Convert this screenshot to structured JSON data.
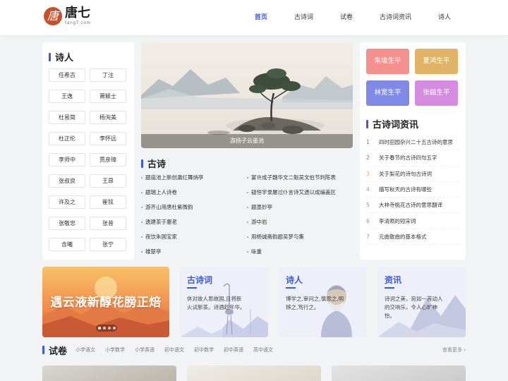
{
  "header": {
    "logo_mark": "唐",
    "logo_name": "唐七",
    "logo_url": "tang7.com",
    "nav": [
      "首页",
      "古诗词",
      "试卷",
      "古诗词资讯",
      "诗人"
    ],
    "active_nav": 0
  },
  "poets": {
    "title": "诗人",
    "items": [
      "任希古",
      "丁注",
      "王逸",
      "萧颖士",
      "杜易简",
      "杨洵美",
      "杜正伦",
      "李怀远",
      "李师中",
      "贾彦璋",
      "张叔良",
      "王昂",
      "许及之",
      "崔铉",
      "张敬忠",
      "张昔",
      "含曦",
      "张宁"
    ]
  },
  "hero": {
    "caption": "游扬子云墨池"
  },
  "gushi": {
    "title": "古诗",
    "items": [
      "题庙池上新创瀛红舞绡亭",
      "宴许成子魏华文二魁吴文伯节判陈表",
      "题瑞上人诗卷",
      "疑恒学录屡过仆言诗又遗以成编盖区",
      "游齐山用唐杜紫微韵",
      "题墨妙亭",
      "遗建茶于惠老",
      "游中岩",
      "夜饮朱国宝家",
      "用杨诚斋韵题吴梦与集",
      "雄楚亭",
      "咏重"
    ]
  },
  "right": {
    "tiles": [
      {
        "label": "朱埴生平",
        "color": "#f4918f"
      },
      {
        "label": "夏鸿生平",
        "color": "#e0b366"
      },
      {
        "label": "林宽生平",
        "color": "#7e8ae6"
      },
      {
        "label": "张鎡生平",
        "color": "#d58be0"
      }
    ],
    "news_title": "古诗词资讯",
    "news": [
      {
        "num": "1",
        "text": "四时田园杂兴二十五古诗的意思"
      },
      {
        "num": "2",
        "text": "关于春节的古诗四句五字"
      },
      {
        "num": "3",
        "text": "关于梨花的诗句古诗词"
      },
      {
        "num": "4",
        "text": "描写秋天的古诗有哪些"
      },
      {
        "num": "5",
        "text": "大林寺桃花古诗的意思翻译"
      },
      {
        "num": "6",
        "text": "李清照的短宋词"
      },
      {
        "num": "7",
        "text": "元曲散曲的基本格式"
      }
    ]
  },
  "banner": {
    "text": "遇云液新醇花膀正焙"
  },
  "cards": [
    {
      "title": "古诗词",
      "desc": "休对故人思故国,且将新火试新茶。诗酒趁年华。"
    },
    {
      "title": "诗人",
      "desc": "博学之,审问之,慎思之,明辨之,笃行之。"
    },
    {
      "title": "资讯",
      "desc": "诗词之美，宛如一首动人的交响乐，令人心旷神怡。"
    }
  ],
  "exam": {
    "title": "试卷",
    "tabs": [
      "小学语文",
      "小学数学",
      "小学英语",
      "初中语文",
      "初中数学",
      "初中英语",
      "高中语文"
    ],
    "more": "查看更多 ›"
  }
}
